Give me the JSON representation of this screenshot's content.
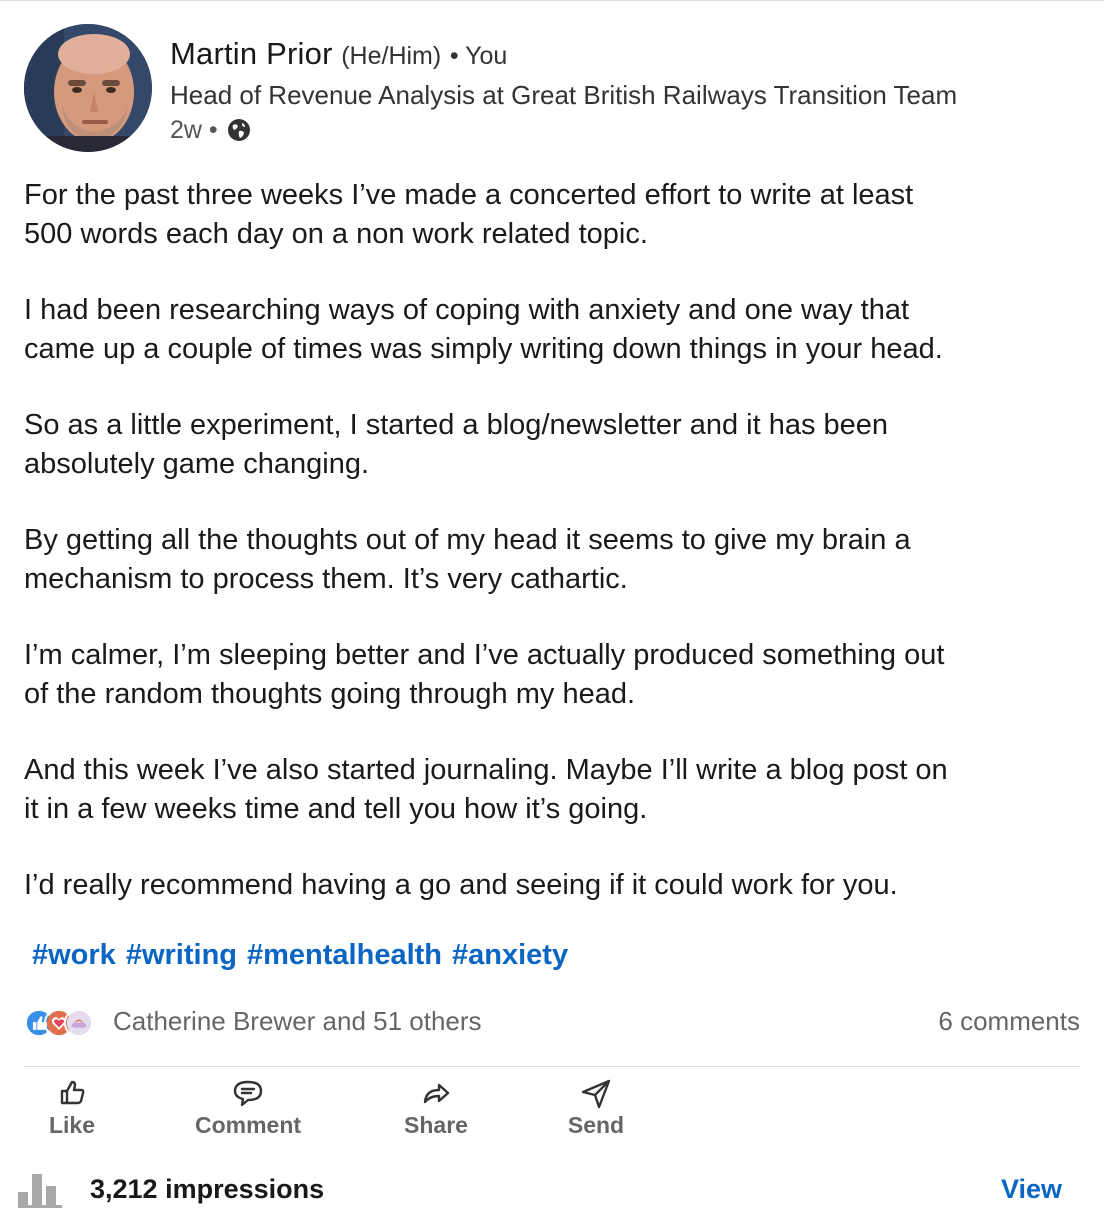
{
  "author": {
    "name": "Martin Prior",
    "pronouns": "(He/Him)",
    "degree": "• You",
    "headline": "Head of Revenue Analysis at Great British Railways Transition Team",
    "time": "2w •",
    "visibility_icon": "globe-icon"
  },
  "post": {
    "paragraphs": [
      "For the past three weeks I’ve made a concerted effort to write at least\n500 words each day on a non work related topic.",
      "I had been researching ways of coping with anxiety and one way that\ncame up a couple of times was simply writing down things in your head.",
      "So as a little experiment, I started a blog/newsletter and it has been\nabsolutely game changing.",
      "By getting all the thoughts out of my head it seems to give my brain a\nmechanism to process them. It’s very cathartic.",
      "I’m calmer, I’m sleeping better and I’ve actually produced something out\nof the random thoughts going through my head.",
      "And this week I’ve also started journaling. Maybe I’ll write a blog post on\nit in a few weeks time and tell you how it’s going.",
      "I’d really recommend having a go and seeing if it could work for you."
    ],
    "hashtags": [
      "#work",
      "#writing",
      "#mentalhealth",
      "#anxiety"
    ]
  },
  "social": {
    "reactions_icons": [
      "like-icon",
      "love-icon",
      "support-icon"
    ],
    "reactors_text": "Catherine Brewer and 51 others",
    "comments_text": "6 comments"
  },
  "actions": {
    "like": "Like",
    "comment": "Comment",
    "share": "Share",
    "send": "Send"
  },
  "analytics": {
    "impressions_text": "3,212 impressions",
    "view_label": "View"
  },
  "colors": {
    "link_blue": "#0a66c2",
    "muted_text": "#666666"
  }
}
